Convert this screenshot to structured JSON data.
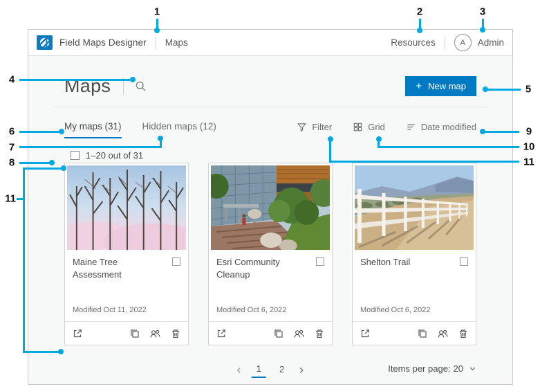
{
  "colors": {
    "accent": "#007ac2",
    "callout": "#00a9e0",
    "logo_blue": "#0c7ac0"
  },
  "header": {
    "logo_icon": "esri-globe-logo",
    "app_title": "Field Maps Designer",
    "breadcrumb": "Maps",
    "resources": "Resources",
    "avatar_initial": "A",
    "user_name": "Admin"
  },
  "toolbar": {
    "title": "Maps",
    "search_icon": "magnifying-glass",
    "new_map_button": {
      "plus": "+",
      "label": "New map"
    }
  },
  "tabs": {
    "my_maps": "My maps (31)",
    "hidden_maps": "Hidden maps (12)"
  },
  "list_controls": {
    "filter": "Filter",
    "view": "Grid",
    "sort": "Date modified"
  },
  "selection": {
    "label": "1–20 out of 31"
  },
  "cards": [
    {
      "title": "Maine Tree Assessment",
      "modified": "Modified Oct 11, 2022"
    },
    {
      "title": "Esri Community Cleanup",
      "modified": "Modified Oct 6, 2022"
    },
    {
      "title": "Shelton Trail",
      "modified": "Modified Oct 6, 2022"
    }
  ],
  "pagination": {
    "prev": "‹",
    "pages": [
      "1",
      "2"
    ],
    "current_page": "1",
    "next": "›",
    "items_per_page_label": "Items per page:",
    "items_per_page_value": "20"
  },
  "callouts": {
    "items": [
      "1",
      "2",
      "3",
      "4",
      "5",
      "6",
      "7",
      "8",
      "9",
      "10",
      "11",
      "11"
    ]
  }
}
